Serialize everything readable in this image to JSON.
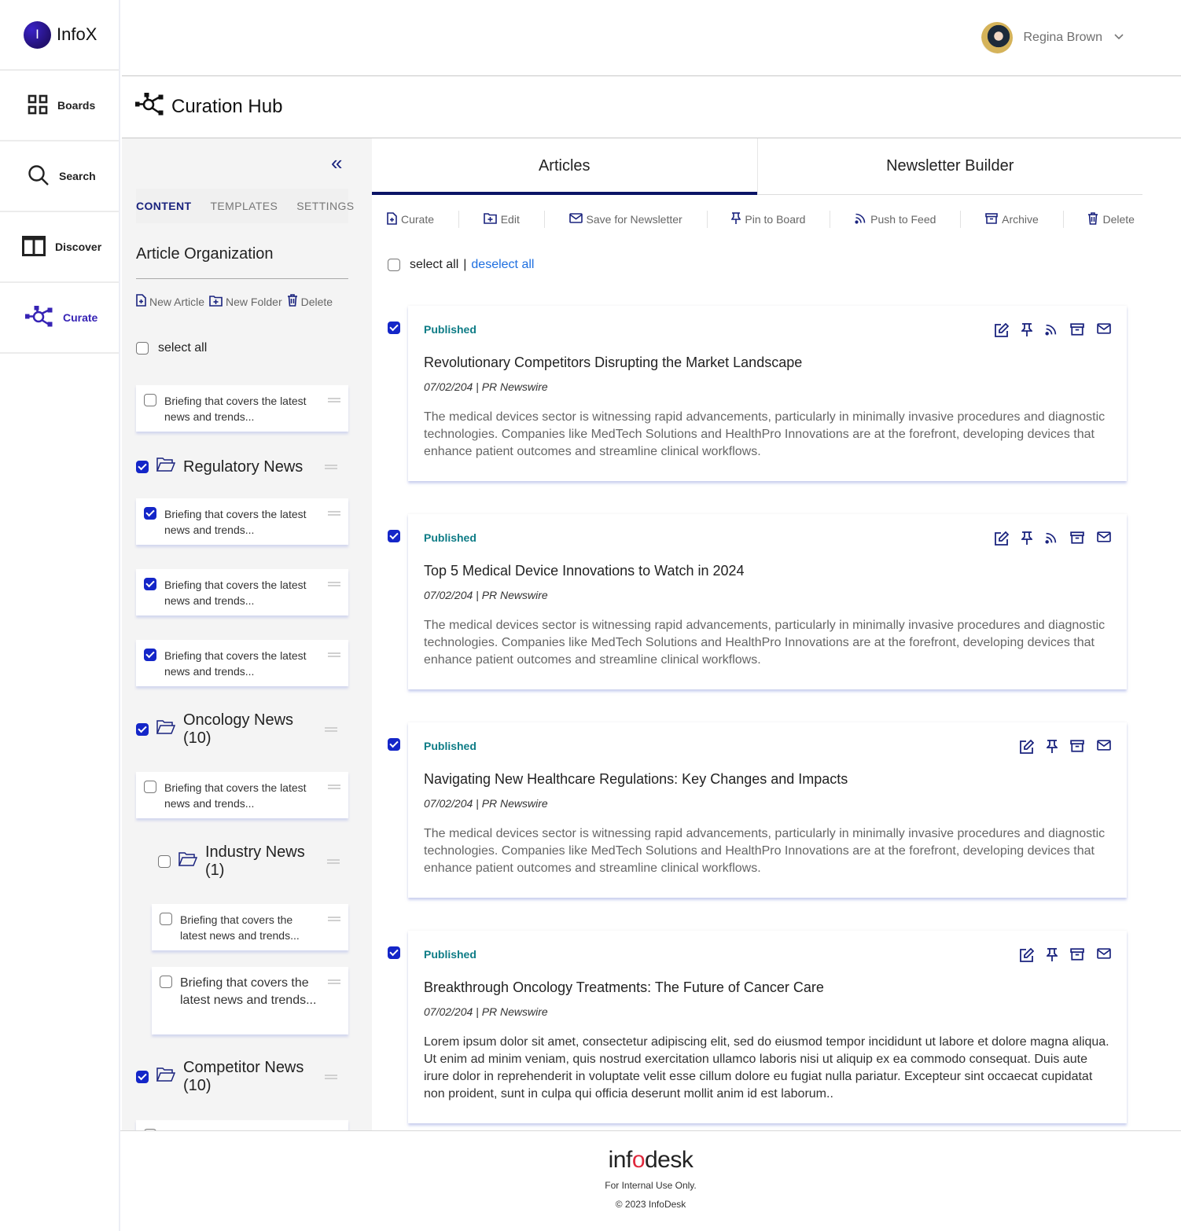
{
  "app": {
    "name": "InfoX",
    "logo_letter": "I"
  },
  "nav": {
    "items": [
      {
        "label": "Boards",
        "icon": "grid-icon",
        "active": false
      },
      {
        "label": "Search",
        "icon": "search-icon",
        "active": false
      },
      {
        "label": "Discover",
        "icon": "columns-icon",
        "active": false
      },
      {
        "label": "Curate",
        "icon": "network-icon",
        "active": true
      }
    ]
  },
  "user": {
    "name": "Regina Brown"
  },
  "page": {
    "title": "Curation Hub"
  },
  "panel": {
    "tabs": [
      {
        "label": "CONTENT",
        "active": true
      },
      {
        "label": "TEMPLATES",
        "active": false
      },
      {
        "label": "SETTINGS",
        "active": false
      }
    ],
    "section_title": "Article Organization",
    "actions": {
      "new_article": "New Article",
      "new_folder": "New Folder",
      "delete": "Delete"
    },
    "select_all": "select all",
    "tree": [
      {
        "type": "item",
        "text": "Briefing that covers the latest news and trends...",
        "checked": false
      },
      {
        "type": "folder",
        "text": "Regulatory News",
        "checked": true
      },
      {
        "type": "item",
        "text": "Briefing that covers the latest news and trends...",
        "checked": true
      },
      {
        "type": "item",
        "text": "Briefing that covers the latest news and trends...",
        "checked": true
      },
      {
        "type": "item",
        "text": "Briefing that covers the latest news and trends...",
        "checked": true
      },
      {
        "type": "folder",
        "text": "Oncology News (10)",
        "checked": true
      },
      {
        "type": "item",
        "text": "Briefing that covers the latest news and trends...",
        "checked": false
      },
      {
        "type": "folder",
        "text": "Industry News (1)",
        "checked": false
      },
      {
        "type": "item",
        "text": "Briefing that covers the latest news and trends...",
        "checked": false
      },
      {
        "type": "item",
        "text": "Briefing that covers the latest news and trends...",
        "checked": false
      },
      {
        "type": "folder",
        "text": "Competitor News (10)",
        "checked": true
      }
    ]
  },
  "main": {
    "tabs": [
      {
        "label": "Articles",
        "active": true
      },
      {
        "label": "Newsletter Builder",
        "active": false
      }
    ],
    "toolbar": {
      "curate": "Curate",
      "edit": "Edit",
      "save_newsletter": "Save for Newsletter",
      "pin": "Pin to Board",
      "push": "Push to Feed",
      "archive": "Archive",
      "delete": "Delete"
    },
    "select_all": "select all",
    "separator": "|",
    "deselect_all": "deselect all",
    "articles": [
      {
        "checked": true,
        "status": "Published",
        "title": "Revolutionary Competitors Disrupting the Market Landscape",
        "meta": "07/02/204 | PR Newswire",
        "body": "The medical devices sector is witnessing rapid advancements, particularly in minimally invasive procedures and diagnostic technologies. Companies like MedTech Solutions and HealthPro Innovations are at the forefront, developing devices that enhance patient outcomes and streamline clinical workflows.",
        "icons": [
          "edit-icon",
          "pin-icon",
          "rss-icon",
          "archive-icon",
          "mail-icon"
        ]
      },
      {
        "checked": true,
        "status": "Published",
        "title": "Top 5 Medical Device Innovations to Watch in 2024",
        "meta": "07/02/204 | PR Newswire",
        "body": "The medical devices sector is witnessing rapid advancements, particularly in minimally invasive procedures and diagnostic technologies. Companies like MedTech Solutions and HealthPro Innovations are at the forefront, developing devices that enhance patient outcomes and streamline clinical workflows.",
        "icons": [
          "edit-icon",
          "pin-icon",
          "rss-icon",
          "archive-icon",
          "mail-icon"
        ]
      },
      {
        "checked": true,
        "status": "Published",
        "title": "Navigating New Healthcare Regulations: Key Changes and Impacts",
        "meta": "07/02/204 | PR Newswire",
        "body": "The medical devices sector is witnessing rapid advancements, particularly in minimally invasive procedures and diagnostic technologies. Companies like MedTech Solutions and HealthPro Innovations are at the forefront, developing devices that enhance patient outcomes and streamline clinical workflows.",
        "icons": [
          "edit-icon",
          "pin-icon",
          "archive-icon",
          "mail-icon"
        ]
      },
      {
        "checked": true,
        "status": "Published",
        "title": "Breakthrough Oncology Treatments: The Future of Cancer Care",
        "meta": "07/02/204 | PR Newswire",
        "body": "Lorem ipsum dolor sit amet, consectetur adipiscing elit, sed do eiusmod tempor incididunt ut labore et dolore magna aliqua. Ut enim ad minim veniam, quis nostrud exercitation ullamco laboris nisi ut aliquip ex ea commodo consequat. Duis aute irure dolor in reprehenderit in voluptate velit esse cillum dolore eu fugiat nulla pariatur. Excepteur sint occaecat cupidatat non proident, sunt in culpa qui officia deserunt mollit anim id est laborum..",
        "icons": [
          "edit-icon",
          "pin-icon",
          "archive-icon",
          "mail-icon"
        ]
      }
    ]
  },
  "footer": {
    "brand_pre": "inf",
    "brand_o": "o",
    "brand_post": "desk",
    "note": "For Internal Use Only.",
    "copyright": "© 2023 InfoDesk"
  },
  "colors": {
    "accent": "#1a237e",
    "checkbox": "#1426c8",
    "status": "#0e7c86",
    "link": "#1e6fe0",
    "nav_active": "#3623b5"
  }
}
